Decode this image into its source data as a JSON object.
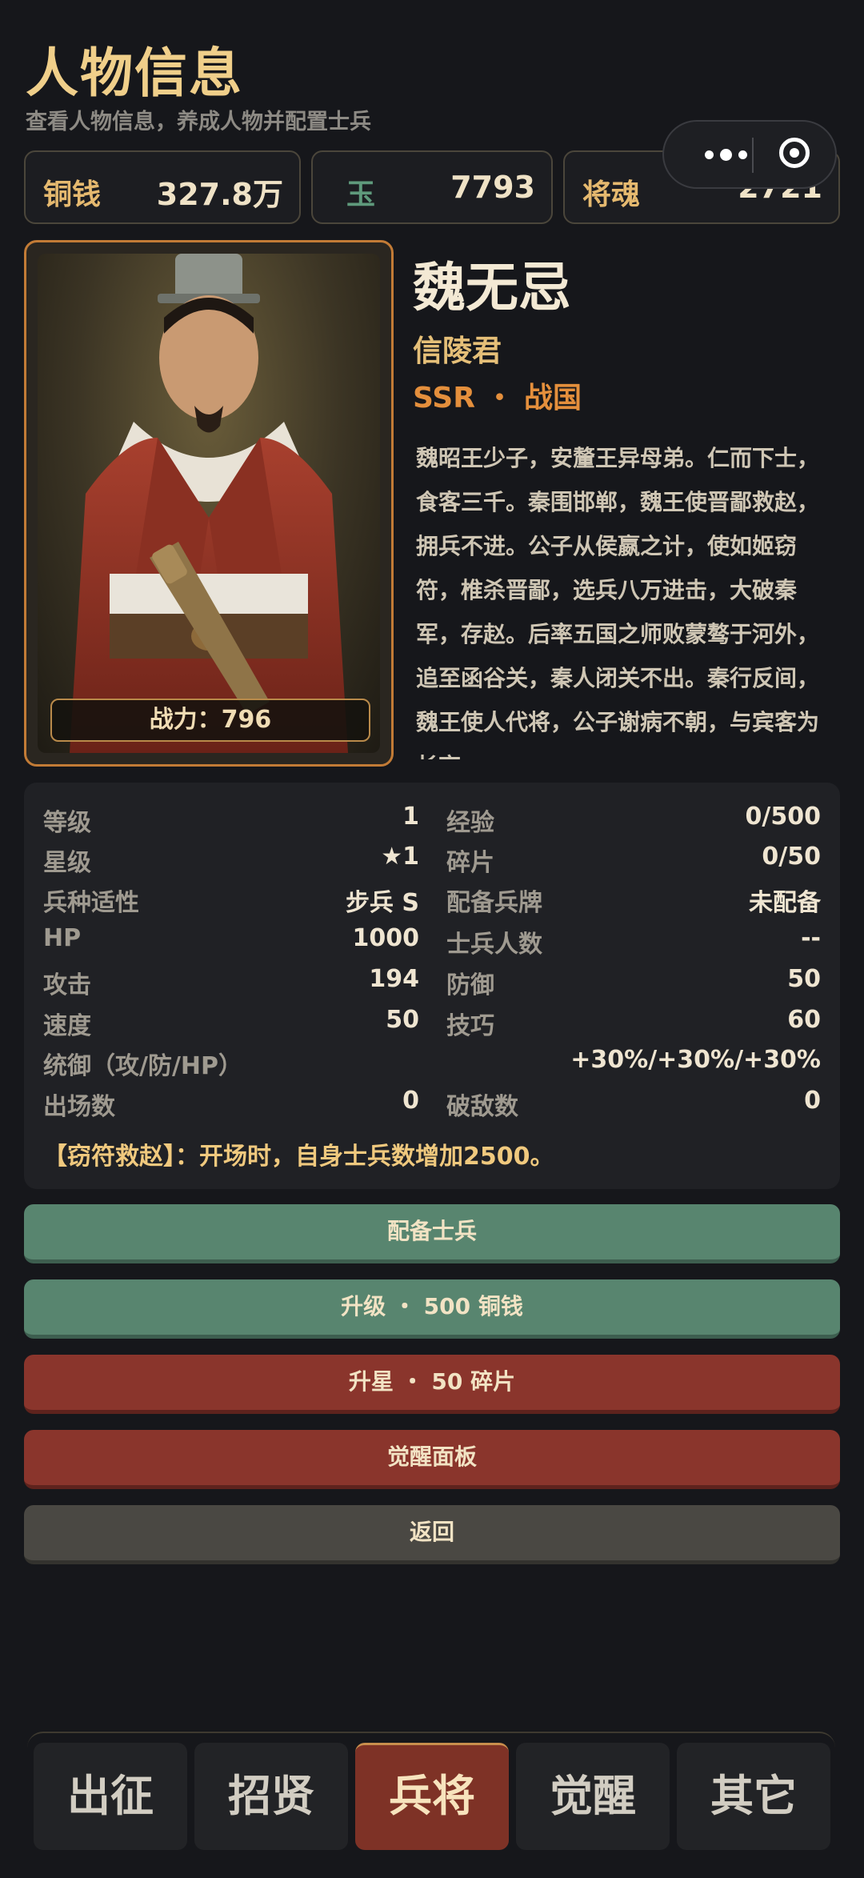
{
  "header": {
    "title": "人物信息",
    "subtitle": "查看人物信息，养成人物并配置士兵"
  },
  "currencies": [
    {
      "label": "铜钱",
      "value": "327.8万",
      "color": "#e5b96f"
    },
    {
      "label": "玉",
      "value": "7793",
      "color": "#5f9a7c"
    },
    {
      "label": "将魂",
      "value": "2721",
      "color": "#e5b96f"
    }
  ],
  "hero": {
    "name": "魏无忌",
    "alias": "信陵君",
    "rarity": "SSR ・ 战国",
    "power": "战力：796",
    "bio": "魏昭王少子，安釐王异母弟。仁而下士，食客三千。秦围邯郸，魏王使晋鄙救赵，拥兵不进。公子从侯嬴之计，使如姬窃符，椎杀晋鄙，选兵八万进击，大破秦军，存赵。后率五国之师败蒙骜于河外，追至函谷关，秦人闭关不出。秦行反间，魏王使人代将，公子谢病不朝，与宾客为长夜"
  },
  "stats": {
    "level_label": "等级",
    "level": "1",
    "exp_label": "经验",
    "exp": "0/500",
    "star_label": "星级",
    "star": "★1",
    "shard_label": "碎片",
    "shard": "0/50",
    "arm_label": "兵种适性",
    "arm": "步兵 S",
    "token_label": "配备兵牌",
    "token": "未配备",
    "hp_label": "HP",
    "hp": "1000",
    "soldiers_label": "士兵人数",
    "soldiers": "--",
    "atk_label": "攻击",
    "atk": "194",
    "def_label": "防御",
    "def": "50",
    "spd_label": "速度",
    "spd": "50",
    "skill_label": "技巧",
    "skill": "60",
    "command_label": "统御（攻/防/HP）",
    "command": "+30%/+30%/+30%",
    "appear_label": "出场数",
    "appear": "0",
    "kill_label": "破敌数",
    "kill": "0"
  },
  "skill_text": "【窃符救赵】：开场时，自身士兵数增加2500。",
  "buttons": {
    "equip": "配备士兵",
    "upgrade": "升级 ・ 500 铜钱",
    "star_up": "升星 ・ 50 碎片",
    "awaken_panel": "觉醒面板",
    "back": "返回"
  },
  "nav": {
    "tabs": [
      "出征",
      "招贤",
      "兵将",
      "觉醒",
      "其它"
    ],
    "active": "兵将"
  }
}
